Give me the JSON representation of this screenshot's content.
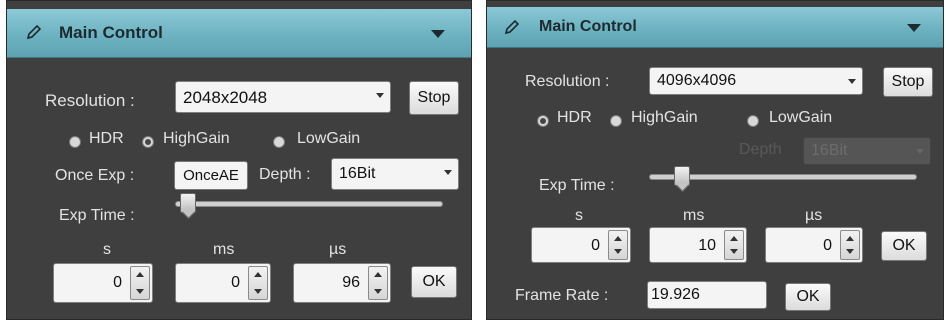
{
  "left": {
    "title": "Main Control",
    "resolution_label": "Resolution :",
    "resolution_value": "2048x2048",
    "stop_label": "Stop",
    "hdr_label": "HDR",
    "highgain_label": "HighGain",
    "lowgain_label": "LowGain",
    "gain_mode": "HighGain",
    "once_exp_label": "Once Exp :",
    "once_ae_label": "OnceAE",
    "depth_label": "Depth :",
    "depth_value": "16Bit",
    "exp_time_label": "Exp Time :",
    "exp_slider_fraction": 0.02,
    "s_label": "s",
    "ms_label": "ms",
    "us_label": "µs",
    "s_value": "0",
    "ms_value": "0",
    "us_value": "96",
    "ok_label": "OK"
  },
  "right": {
    "title": "Main Control",
    "resolution_label": "Resolution :",
    "resolution_value": "4096x4096",
    "stop_label": "Stop",
    "hdr_label": "HDR",
    "highgain_label": "HighGain",
    "lowgain_label": "LowGain",
    "gain_mode": "HDR",
    "depth_label": "Depth",
    "depth_value": "16Bit",
    "exp_time_label": "Exp Time :",
    "exp_slider_fraction": 0.1,
    "s_label": "s",
    "ms_label": "ms",
    "us_label": "µs",
    "s_value": "0",
    "ms_value": "10",
    "us_value": "0",
    "ok_label": "OK",
    "frame_rate_label": "Frame Rate :",
    "frame_rate_value": "19.926",
    "frame_ok_label": "OK"
  },
  "colors": {
    "header_accent": "#6db2c1",
    "panel_background": "#3f3f3f"
  }
}
